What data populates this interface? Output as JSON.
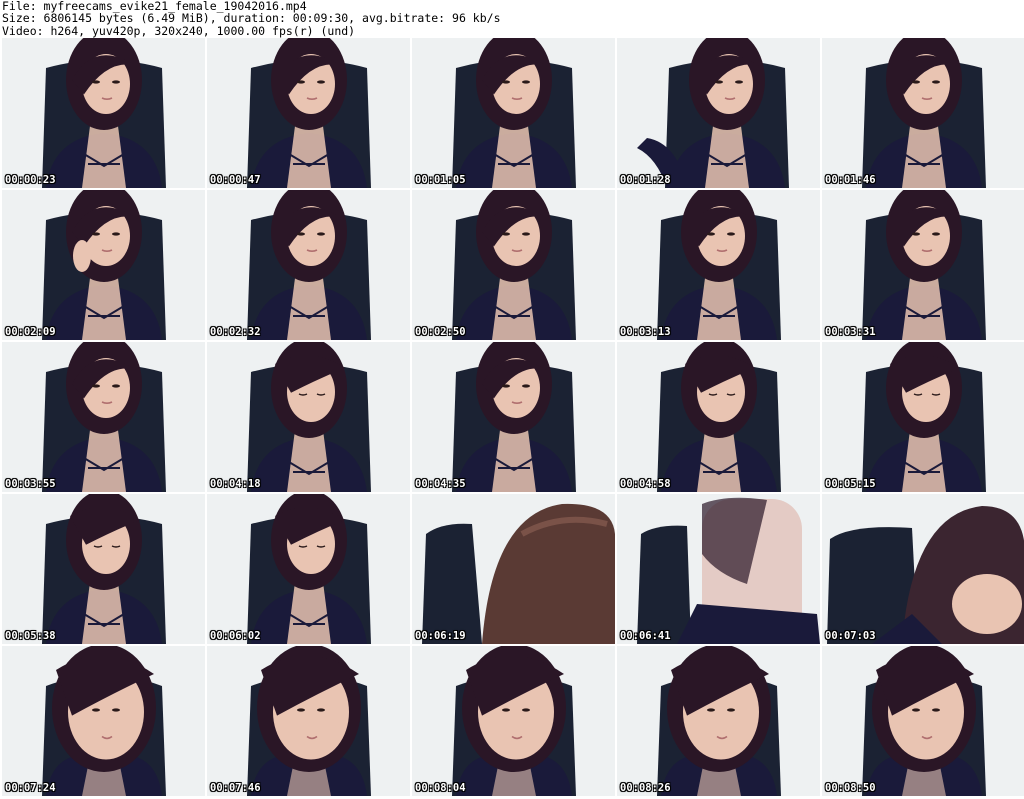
{
  "header": {
    "file_line": "File: myfreecams_evike21_female_19042016.mp4",
    "size_line": "Size: 6806145 bytes (6.49 MiB), duration: 00:09:30, avg.bitrate: 96 kb/s",
    "video_line": "Video: h264, yuv420p, 320x240, 1000.00 fps(r) (und)"
  },
  "colors": {
    "wall": "#eef1f2",
    "chair": "#1b2233",
    "hair": "#2a1626",
    "skin": "#e9c4b2",
    "shirt": "#1a1a3a"
  },
  "thumbnails": [
    {
      "timestamp": "00:00:23",
      "pose": "center"
    },
    {
      "timestamp": "00:00:47",
      "pose": "center"
    },
    {
      "timestamp": "00:01:05",
      "pose": "center"
    },
    {
      "timestamp": "00:01:28",
      "pose": "reach"
    },
    {
      "timestamp": "00:01:46",
      "pose": "center"
    },
    {
      "timestamp": "00:02:09",
      "pose": "hand"
    },
    {
      "timestamp": "00:02:32",
      "pose": "center"
    },
    {
      "timestamp": "00:02:50",
      "pose": "center"
    },
    {
      "timestamp": "00:03:13",
      "pose": "center"
    },
    {
      "timestamp": "00:03:31",
      "pose": "center"
    },
    {
      "timestamp": "00:03:55",
      "pose": "center"
    },
    {
      "timestamp": "00:04:18",
      "pose": "down"
    },
    {
      "timestamp": "00:04:35",
      "pose": "center"
    },
    {
      "timestamp": "00:04:58",
      "pose": "down"
    },
    {
      "timestamp": "00:05:15",
      "pose": "down"
    },
    {
      "timestamp": "00:05:38",
      "pose": "down"
    },
    {
      "timestamp": "00:06:02",
      "pose": "down"
    },
    {
      "timestamp": "00:06:19",
      "pose": "closeup"
    },
    {
      "timestamp": "00:06:41",
      "pose": "blur"
    },
    {
      "timestamp": "00:07:03",
      "pose": "lean"
    },
    {
      "timestamp": "00:07:24",
      "pose": "close"
    },
    {
      "timestamp": "00:07:46",
      "pose": "close"
    },
    {
      "timestamp": "00:08:04",
      "pose": "close"
    },
    {
      "timestamp": "00:08:26",
      "pose": "close"
    },
    {
      "timestamp": "00:08:50",
      "pose": "close"
    }
  ]
}
